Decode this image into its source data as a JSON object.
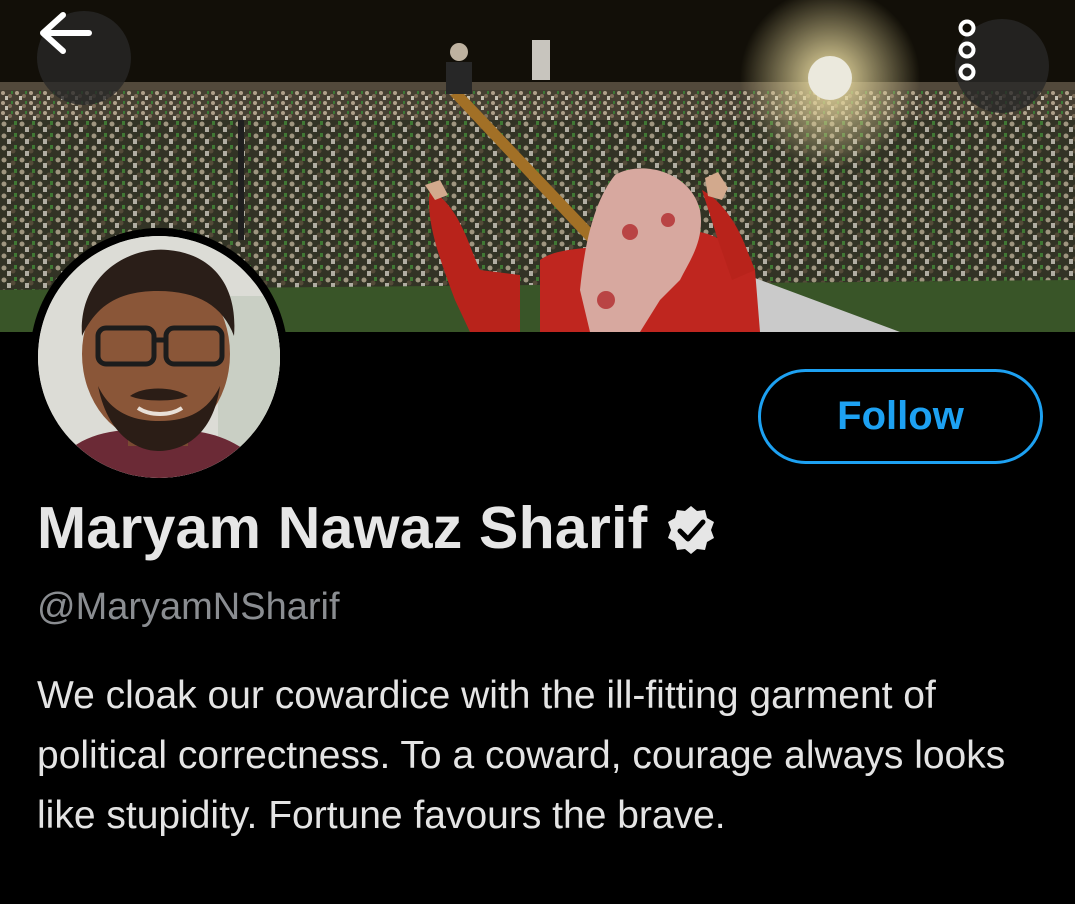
{
  "header": {
    "back_icon": "arrow-left-icon",
    "more_icon": "more-vertical-icon"
  },
  "profile": {
    "name": "Maryam Nawaz Sharif",
    "verified": true,
    "verified_icon": "verified-badge-icon",
    "handle": "@MaryamNSharif",
    "bio": "We cloak our cowardice with the ill-fitting garment of political correctness. To a coward, courage always looks like stupidity. Fortune favours the brave.",
    "follow_label": "Follow"
  },
  "colors": {
    "accent": "#1da1f2",
    "background": "#000000",
    "name_text": "#e6e6e6",
    "handle_text": "#8a8d91"
  }
}
